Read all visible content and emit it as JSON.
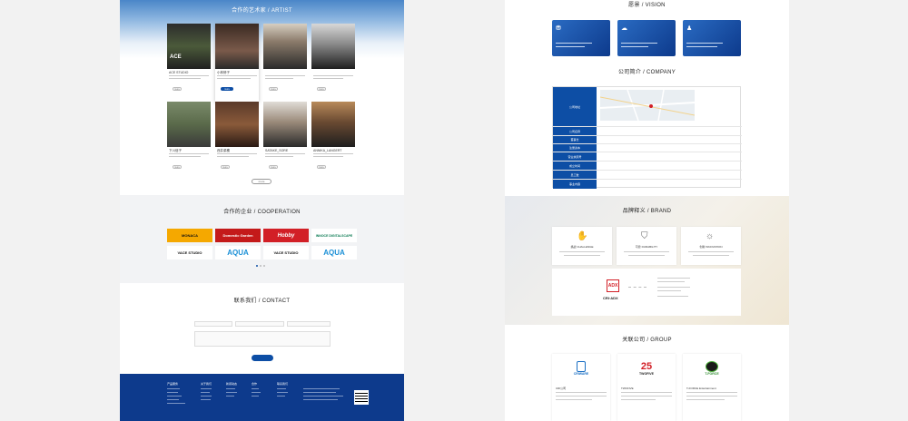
{
  "left_page": {
    "artist": {
      "title": "合作的艺术家 / ARTIST",
      "artists": [
        {
          "name": "ACE STUDIO"
        },
        {
          "name": "小林修子"
        },
        {
          "name": ""
        },
        {
          "name": ""
        },
        {
          "name": "下川信子"
        },
        {
          "name": "西井菜穂"
        },
        {
          "name": "SATAKE_SORE"
        },
        {
          "name": "ANNIKA_LANGERT"
        }
      ],
      "more_label": "more",
      "load_more_label": "more"
    },
    "cooperation": {
      "title": "合作的企业 / COOPERATION",
      "logos": [
        "MONACA",
        "Domestic Garden",
        "Hobby",
        "INNOCE DIGITALSCAPE",
        "VACE STUDIO",
        "AQUA",
        "VACE STUDIO",
        "AQUA"
      ]
    },
    "contact": {
      "title": "联系我们 / CONTACT",
      "fields": {
        "f1": "",
        "f2": "",
        "f3": "",
        "message": ""
      },
      "submit_label": ""
    },
    "footer": {
      "columns": [
        "产品服务",
        "关于我们",
        "新闻动态",
        "合作",
        "联系我们"
      ]
    }
  },
  "right_page": {
    "vision": {
      "title": "愿景 / VISION"
    },
    "company": {
      "title": "公司简介 / COMPANY",
      "rows": [
        {
          "key": "公司地址",
          "value": ""
        },
        {
          "key": "公司名称",
          "value": ""
        },
        {
          "key": "董事长",
          "value": ""
        },
        {
          "key": "注册资本",
          "value": ""
        },
        {
          "key": "营业执照号",
          "value": ""
        },
        {
          "key": "成立时间",
          "value": ""
        },
        {
          "key": "员工数",
          "value": ""
        },
        {
          "key": "事业内容",
          "value": ""
        }
      ]
    },
    "brand": {
      "title": "品牌释义 / BRAND",
      "cards": [
        {
          "label": "挑战 CHALLENGE",
          "icon": "hand-icon"
        },
        {
          "label": "可靠 DURABILITY",
          "icon": "shield-icon"
        },
        {
          "label": "创新 INNOVATION",
          "icon": "bulb-icon"
        }
      ],
      "logo_text": "ADX",
      "logo_wordmark": "CRI·ADX"
    },
    "group": {
      "title": "关联公司 / GROUP",
      "companies": [
        {
          "logo": "CRIWARE",
          "name": "CRI公司"
        },
        {
          "logo": "TWOFIVE",
          "name": "TWOFIVE"
        },
        {
          "logo": "T-FORCE",
          "name": "T-FORCE Entertainment"
        }
      ]
    }
  },
  "colors": {
    "primary": "#0d4ea5",
    "footer": "#0d3a8c",
    "accent_red": "#d21f26",
    "accent_yellow": "#f5a800"
  }
}
